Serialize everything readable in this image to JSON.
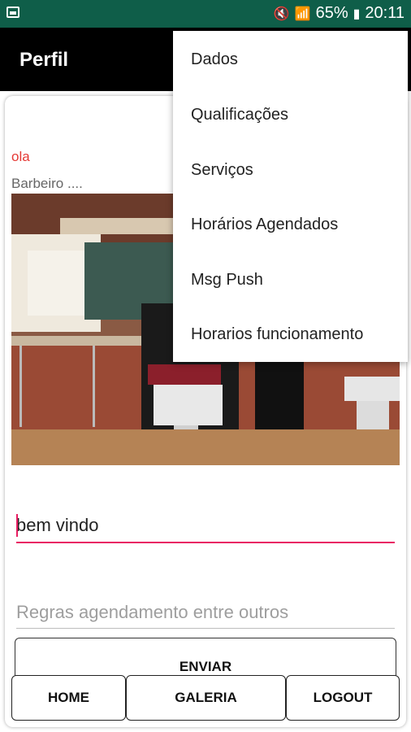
{
  "status_bar": {
    "battery": "65%",
    "time": "20:11",
    "icons": [
      "image-icon",
      "mute-icon",
      "wifi-icon",
      "signal-icon",
      "battery-icon"
    ]
  },
  "app_bar": {
    "title": "Perfil"
  },
  "profile": {
    "greeting": "ola",
    "subtitle": "Barbeiro ....",
    "photo_alt": "barbershop-photo"
  },
  "form": {
    "message_value": "bem vindo",
    "rules_placeholder": "Regras agendamento entre outros",
    "send_label": "ENVIAR"
  },
  "bottom_nav": {
    "home": "HOME",
    "gallery": "GALERIA",
    "logout": "LOGOUT"
  },
  "overflow_menu": {
    "items": [
      "Dados",
      "Qualificações",
      "Serviços",
      "Horários Agendados",
      "Msg Push",
      "Horarios funcionamento"
    ]
  },
  "colors": {
    "status_bar": "#0f5e49",
    "app_bar": "#000000",
    "accent": "#e91e63",
    "greeting": "#e53935"
  }
}
